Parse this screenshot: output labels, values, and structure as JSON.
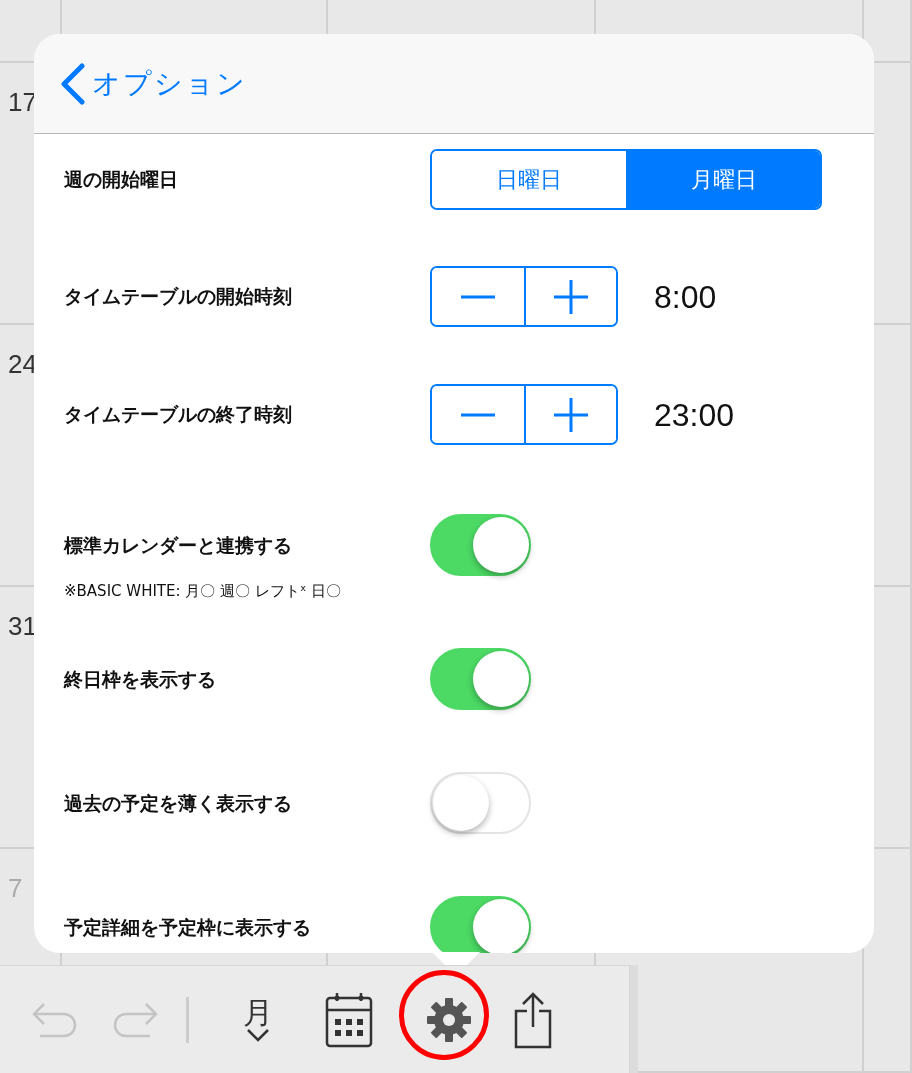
{
  "calendar": {
    "dates": [
      {
        "label": "17",
        "muted": false
      },
      {
        "label": "24",
        "muted": false
      },
      {
        "label": "31",
        "muted": false
      },
      {
        "label": "7",
        "muted": true
      }
    ]
  },
  "popover": {
    "back_label": "オプション",
    "settings": [
      {
        "kind": "segmented",
        "label": "週の開始曜日",
        "options": [
          {
            "label": "日曜日",
            "selected": false
          },
          {
            "label": "月曜日",
            "selected": true
          }
        ]
      },
      {
        "kind": "stepper",
        "label": "タイムテーブルの開始時刻",
        "value": "8:00"
      },
      {
        "kind": "stepper",
        "label": "タイムテーブルの終了時刻",
        "value": "23:00"
      },
      {
        "kind": "toggle",
        "label": "標準カレンダーと連携する",
        "note": "※BASIC WHITE: 月〇 週〇 レフトˣ 日〇",
        "on": true
      },
      {
        "kind": "toggle",
        "label": "終日枠を表示する",
        "on": true
      },
      {
        "kind": "toggle",
        "label": "過去の予定を薄く表示する",
        "on": false
      },
      {
        "kind": "toggle",
        "label": "予定詳細を予定枠に表示する",
        "on": true
      }
    ]
  },
  "toolbar": {
    "items": [
      {
        "kind": "undo",
        "disabled": true
      },
      {
        "kind": "redo",
        "disabled": true
      },
      {
        "kind": "divider"
      },
      {
        "kind": "month",
        "label": "月"
      },
      {
        "kind": "calendar"
      },
      {
        "kind": "settings",
        "highlighted": true
      },
      {
        "kind": "share"
      }
    ]
  }
}
